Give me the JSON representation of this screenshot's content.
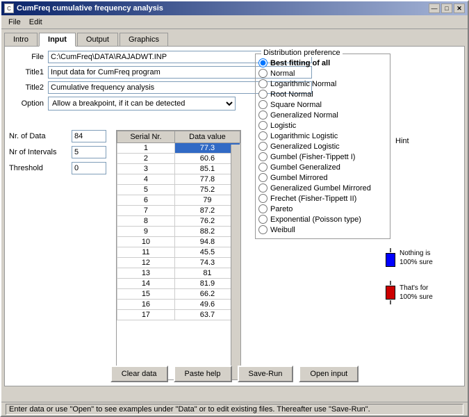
{
  "window": {
    "title": "CumFreq cumulative frequency analysis",
    "icon": "📊"
  },
  "title_bar_buttons": [
    "—",
    "□",
    "✕"
  ],
  "menu": {
    "items": [
      "File",
      "Edit"
    ]
  },
  "tabs": [
    {
      "label": "Intro",
      "active": false
    },
    {
      "label": "Input",
      "active": true
    },
    {
      "label": "Output",
      "active": false
    },
    {
      "label": "Graphics",
      "active": false
    }
  ],
  "form": {
    "file_label": "File",
    "file_value": "C:\\CumFreq\\DATA\\RAJADWT.INP",
    "title1_label": "Title1",
    "title1_value": "Input data for CumFreq program",
    "title2_label": "Title2",
    "title2_value": "Cumulative frequency analysis",
    "option_label": "Option",
    "option_value": "Allow a breakpoint, if it can be detected"
  },
  "fields": {
    "nr_data_label": "Nr. of Data",
    "nr_data_value": "84",
    "nr_intervals_label": "Nr of Intervals",
    "nr_intervals_value": "5",
    "threshold_label": "Threshold",
    "threshold_value": "0"
  },
  "table": {
    "col1": "Serial Nr.",
    "col2": "Data value",
    "rows": [
      {
        "serial": "1",
        "value": "77.3",
        "selected": true
      },
      {
        "serial": "2",
        "value": "60.6"
      },
      {
        "serial": "3",
        "value": "85.1"
      },
      {
        "serial": "4",
        "value": "77.8"
      },
      {
        "serial": "5",
        "value": "75.2"
      },
      {
        "serial": "6",
        "value": "79"
      },
      {
        "serial": "7",
        "value": "87.2"
      },
      {
        "serial": "8",
        "value": "76.2"
      },
      {
        "serial": "9",
        "value": "88.2"
      },
      {
        "serial": "10",
        "value": "94.8"
      },
      {
        "serial": "11",
        "value": "45.5"
      },
      {
        "serial": "12",
        "value": "74.3"
      },
      {
        "serial": "13",
        "value": "81"
      },
      {
        "serial": "14",
        "value": "81.9"
      },
      {
        "serial": "15",
        "value": "66.2"
      },
      {
        "serial": "16",
        "value": "49.6"
      },
      {
        "serial": "17",
        "value": "63.7"
      }
    ]
  },
  "distribution": {
    "panel_title": "Distribution preference",
    "options": [
      {
        "label": "Best fitting of all",
        "value": "best",
        "selected": true,
        "bold": true
      },
      {
        "label": "Normal",
        "value": "normal"
      },
      {
        "label": "Logarithmic Normal",
        "value": "lognormal"
      },
      {
        "label": "Root Normal",
        "value": "rootnormal"
      },
      {
        "label": "Square Normal",
        "value": "squarenormal"
      },
      {
        "label": "Generalized Normal",
        "value": "gennormal"
      },
      {
        "label": "Logistic",
        "value": "logistic"
      },
      {
        "label": "Logarithmic Logistic",
        "value": "loglogistic"
      },
      {
        "label": "Generalized Logistic",
        "value": "genlogistic"
      },
      {
        "label": "Gumbel (Fisher-Tippett I)",
        "value": "gumbel"
      },
      {
        "label": "Gumbel Generalized",
        "value": "gumbelgen"
      },
      {
        "label": "Gumbel Mirrored",
        "value": "gumbelmir"
      },
      {
        "label": "Generalized Gumbel Mirrored",
        "value": "gengumir"
      },
      {
        "label": "Frechet (Fisher-Tippett II)",
        "value": "frechet"
      },
      {
        "label": "Pareto",
        "value": "pareto"
      },
      {
        "label": "Exponential (Poisson type)",
        "value": "exponential"
      },
      {
        "label": "Weibull",
        "value": "weibull"
      }
    ]
  },
  "hint": {
    "label": "Hint",
    "nothing_sure": "Nothing is\n100% sure",
    "thats_sure": "That's for\n100% sure"
  },
  "buttons": {
    "clear_data": "Clear data",
    "paste_help": "Paste help",
    "save_run": "Save-Run",
    "open_input": "Open input"
  },
  "status_bar": {
    "text": "Enter data or use \"Open\" to see examples under \"Data\" or to edit existing files. Thereafter use \"Save-Run\"."
  }
}
